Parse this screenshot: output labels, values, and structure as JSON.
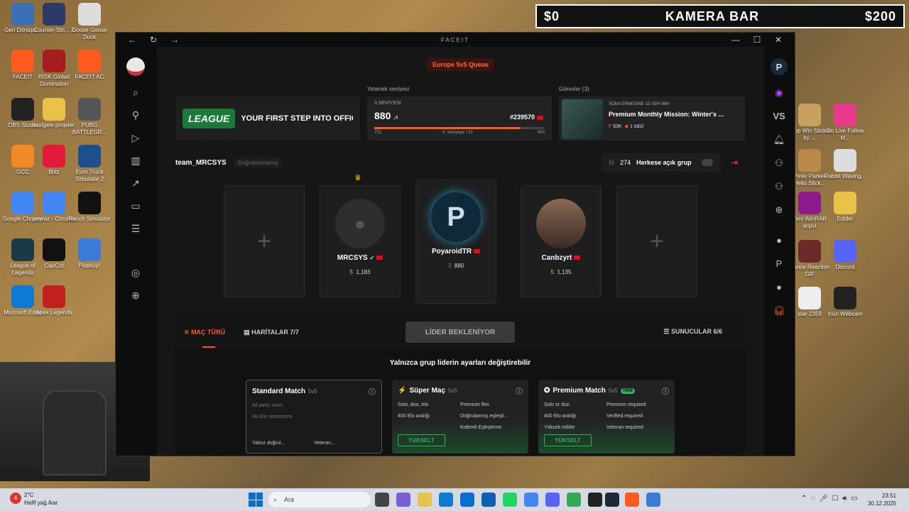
{
  "desktop_icons": [
    {
      "label": "Geri Dönüşü...",
      "color": "#3b6fb6"
    },
    {
      "label": "Counter-Stri... 2",
      "color": "#2b3a67"
    },
    {
      "label": "Goose Goose Duck",
      "color": "#ddd"
    },
    {
      "label": "FACEIT",
      "color": "#ff5a1f"
    },
    {
      "label": "RISK Global Domination",
      "color": "#a51c1c"
    },
    {
      "label": "FACEIT AC",
      "color": "#ff5a1f"
    },
    {
      "label": "OBS Studio",
      "color": "#222"
    },
    {
      "label": "rastgele projeler",
      "color": "#e8c24a"
    },
    {
      "label": "PUBG BATTLEGR...",
      "color": "#555"
    },
    {
      "label": "GCC",
      "color": "#f08a24"
    },
    {
      "label": "Blitz",
      "color": "#e31b3b"
    },
    {
      "label": "Euro Truck Simulator 2",
      "color": "#1d4f8c"
    },
    {
      "label": "Google Chrome",
      "color": "#4285f4"
    },
    {
      "label": "poyraz - Chrome",
      "color": "#4285f4"
    },
    {
      "label": "Ranch Simulator",
      "color": "#111"
    },
    {
      "label": "League of Legends",
      "color": "#1a3a4a"
    },
    {
      "label": "CapCut",
      "color": "#111"
    },
    {
      "label": "PlateUp!",
      "color": "#3a7bd5"
    },
    {
      "label": "Microsoft Edge",
      "color": "#0f7ad1"
    },
    {
      "label": "Apex Legends",
      "color": "#c21f1f"
    },
    {
      "label": "Loop Win Sticker by ...",
      "color": "#c8a060"
    },
    {
      "label": "Go Live Follow M...",
      "color": "#e83a8a"
    },
    {
      "label": "Peter Parker Hello Stick...",
      "color": "#b88a4a"
    },
    {
      "label": "Rabbit Waving...",
      "color": "#ddd"
    },
    {
      "label": "Yeni WinRAR arşivi",
      "color": "#8b1a8b"
    },
    {
      "label": "Editler",
      "color": "#e8c24a"
    },
    {
      "label": "Dance Reaction GIF",
      "color": "#6a2a2a"
    },
    {
      "label": "Discord",
      "color": "#5865f2"
    },
    {
      "label": "star-2359",
      "color": "#eee"
    },
    {
      "label": "Iriun Webcam",
      "color": "#222"
    }
  ],
  "kamera_bar": {
    "left": "$0",
    "center": "KAMERA BAR",
    "right": "$200"
  },
  "window": {
    "logo": "FACEIT",
    "back": "←",
    "reload": "↻",
    "forward": "→",
    "minimize": "—",
    "maximize": "☐",
    "close": "✕"
  },
  "queue": {
    "label": "Europe 5v5 Queue"
  },
  "league_banner": {
    "badge": "LEAGUE",
    "text": "YOUR FIRST STEP INTO OFFICIAL TEAM COMPETITI"
  },
  "skill": {
    "section": "Yetenek seviyesi",
    "level_text": "3.SEVIYESI",
    "elo": "880",
    "rank": "#239570",
    "progress": 0.86,
    "low": "751",
    "next": "4. Seviyeye +21",
    "high": "900"
  },
  "missions": {
    "section": "Görevler (3)",
    "expires": "SONA ERMESİNE 1D 03H 08M",
    "title": "Premium Monthly Mission: Winter's ...",
    "reward1": "63K",
    "reward2": "1 ödül"
  },
  "team": {
    "name": "team_MRCSYS",
    "status": "Doğrulanmamış",
    "count": "274",
    "privacy": "Herkese açık grup"
  },
  "players": [
    {
      "name": "MRCSYS",
      "elo": "1,183",
      "level": "5",
      "avatar_color": "#2e2e2e"
    },
    {
      "name": "PoyaroidTR",
      "elo": "880",
      "level": "3",
      "avatar_color": "#0e2a3a"
    },
    {
      "name": "Canbzyrt",
      "elo": "1,135",
      "level": "5",
      "avatar_color": "#6a5040"
    }
  ],
  "settings": {
    "tab_match": "MAÇ TÜRÜ",
    "tab_maps": "HARİTALAR 7/7",
    "leader_wait": "LİDER BEKLENİYOR",
    "servers": "SUNUCULAR 6/6",
    "only_leader": "Yalnızca grup liderin ayarları değiştirebilir"
  },
  "match_cards": [
    {
      "title": "Standard Match",
      "format": "5v5",
      "rows": [
        [
          "All party sizes",
          ""
        ],
        [
          "No Elo restrictions",
          ""
        ],
        [
          "Yalnız doğrul...",
          "Veteran..."
        ]
      ],
      "upgrade": "",
      "new": ""
    },
    {
      "title": "Süper Maç",
      "format": "5v5",
      "rows": [
        [
          "Solo, duo, trio",
          "Premium flex"
        ],
        [
          "400 Elo aralığı",
          "Doğrulanmış eşleşti..."
        ],
        [
          "",
          "Kıdemli Eşleştirme"
        ]
      ],
      "upgrade": "YÜKSELT",
      "new": ""
    },
    {
      "title": "Premium Match",
      "format": "5v5",
      "rows": [
        [
          "Solo or duo",
          "Premium required"
        ],
        [
          "400 Elo aralığı",
          "Verified required"
        ],
        [
          "Yüksek riskler",
          "Veteran required"
        ]
      ],
      "upgrade": "YÜKSELT",
      "new": "YENİ"
    }
  ],
  "taskbar": {
    "weather_temp": "2°C",
    "weather_desc": "Hafif yağ./kar",
    "search": "Ara",
    "time": "23:51",
    "date": "30.12.2025",
    "weather_badge": "4"
  }
}
